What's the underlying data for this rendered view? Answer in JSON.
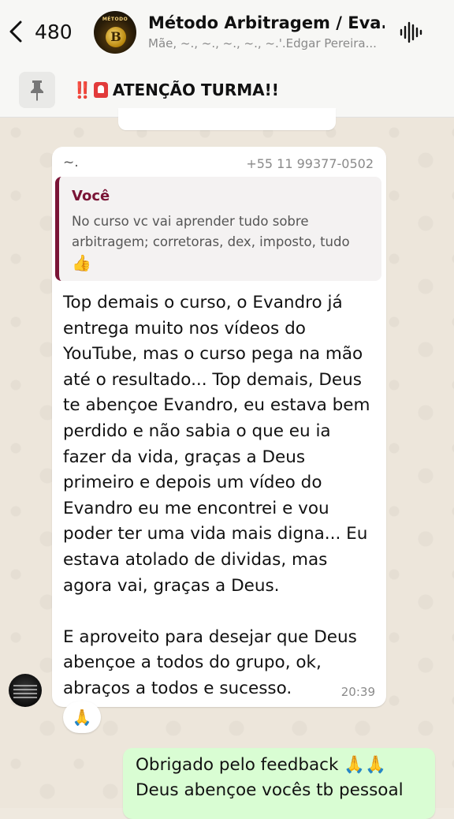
{
  "header": {
    "back_count": "480",
    "avatar_text": "MÉTODO",
    "avatar_coin": "B",
    "title": "Método Arbitragem / Eva...",
    "subtitle": "Mãe, ~., ~., ~., ~., ~.'.Edgar Pereira..."
  },
  "pinned": {
    "exclamation": "‼️",
    "text": "ATENÇÃO TURMA!!"
  },
  "message": {
    "sender": "~.",
    "phone": "+55 11 99377-0502",
    "quote_author": "Você",
    "quote_text": "No curso vc vai aprender tudo sobre arbitragem; corretoras, dex, imposto, tudo",
    "quote_emoji": "👍",
    "text": "Top demais o curso, o Evandro já entrega muito nos vídeos do YouTube, mas o curso pega na mão até o resultado... Top demais, Deus te abençoe Evandro, eu estava bem perdido e não sabia o que eu ia fazer da vida, graças a Deus primeiro e depois um vídeo do Evandro eu me encontrei e vou poder ter uma vida mais digna... Eu estava atolado de dividas, mas agora vai, graças a Deus.\n\nE aproveito para desejar que Deus abençoe a todos do grupo, ok, abraços a todos e sucesso.",
    "time": "20:39",
    "reaction": "🙏"
  },
  "outgoing": {
    "text": "Obrigado pelo feedback 🙏🙏\nDeus abençoe vocês tb pessoal"
  },
  "colors": {
    "quote_accent": "#7a1436",
    "outgoing_bg": "#d9fdd3",
    "chat_bg": "#ede6db"
  }
}
